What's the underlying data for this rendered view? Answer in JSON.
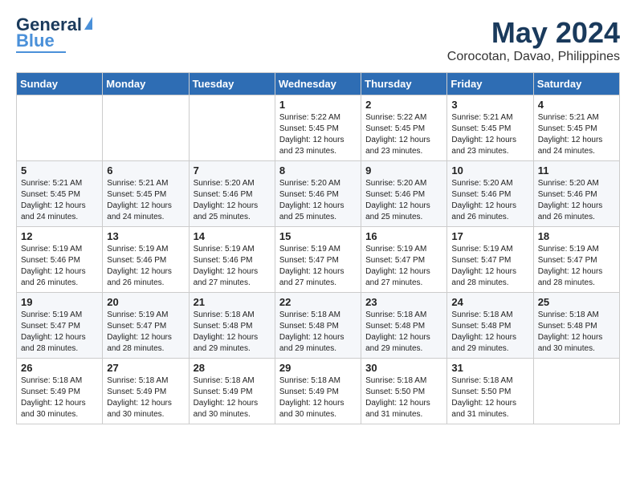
{
  "logo": {
    "line1": "General",
    "line2": "Blue"
  },
  "title": "May 2024",
  "subtitle": "Corocotan, Davao, Philippines",
  "days_of_week": [
    "Sunday",
    "Monday",
    "Tuesday",
    "Wednesday",
    "Thursday",
    "Friday",
    "Saturday"
  ],
  "weeks": [
    [
      {
        "day": "",
        "info": ""
      },
      {
        "day": "",
        "info": ""
      },
      {
        "day": "",
        "info": ""
      },
      {
        "day": "1",
        "info": "Sunrise: 5:22 AM\nSunset: 5:45 PM\nDaylight: 12 hours\nand 23 minutes."
      },
      {
        "day": "2",
        "info": "Sunrise: 5:22 AM\nSunset: 5:45 PM\nDaylight: 12 hours\nand 23 minutes."
      },
      {
        "day": "3",
        "info": "Sunrise: 5:21 AM\nSunset: 5:45 PM\nDaylight: 12 hours\nand 23 minutes."
      },
      {
        "day": "4",
        "info": "Sunrise: 5:21 AM\nSunset: 5:45 PM\nDaylight: 12 hours\nand 24 minutes."
      }
    ],
    [
      {
        "day": "5",
        "info": "Sunrise: 5:21 AM\nSunset: 5:45 PM\nDaylight: 12 hours\nand 24 minutes."
      },
      {
        "day": "6",
        "info": "Sunrise: 5:21 AM\nSunset: 5:45 PM\nDaylight: 12 hours\nand 24 minutes."
      },
      {
        "day": "7",
        "info": "Sunrise: 5:20 AM\nSunset: 5:46 PM\nDaylight: 12 hours\nand 25 minutes."
      },
      {
        "day": "8",
        "info": "Sunrise: 5:20 AM\nSunset: 5:46 PM\nDaylight: 12 hours\nand 25 minutes."
      },
      {
        "day": "9",
        "info": "Sunrise: 5:20 AM\nSunset: 5:46 PM\nDaylight: 12 hours\nand 25 minutes."
      },
      {
        "day": "10",
        "info": "Sunrise: 5:20 AM\nSunset: 5:46 PM\nDaylight: 12 hours\nand 26 minutes."
      },
      {
        "day": "11",
        "info": "Sunrise: 5:20 AM\nSunset: 5:46 PM\nDaylight: 12 hours\nand 26 minutes."
      }
    ],
    [
      {
        "day": "12",
        "info": "Sunrise: 5:19 AM\nSunset: 5:46 PM\nDaylight: 12 hours\nand 26 minutes."
      },
      {
        "day": "13",
        "info": "Sunrise: 5:19 AM\nSunset: 5:46 PM\nDaylight: 12 hours\nand 26 minutes."
      },
      {
        "day": "14",
        "info": "Sunrise: 5:19 AM\nSunset: 5:46 PM\nDaylight: 12 hours\nand 27 minutes."
      },
      {
        "day": "15",
        "info": "Sunrise: 5:19 AM\nSunset: 5:47 PM\nDaylight: 12 hours\nand 27 minutes."
      },
      {
        "day": "16",
        "info": "Sunrise: 5:19 AM\nSunset: 5:47 PM\nDaylight: 12 hours\nand 27 minutes."
      },
      {
        "day": "17",
        "info": "Sunrise: 5:19 AM\nSunset: 5:47 PM\nDaylight: 12 hours\nand 28 minutes."
      },
      {
        "day": "18",
        "info": "Sunrise: 5:19 AM\nSunset: 5:47 PM\nDaylight: 12 hours\nand 28 minutes."
      }
    ],
    [
      {
        "day": "19",
        "info": "Sunrise: 5:19 AM\nSunset: 5:47 PM\nDaylight: 12 hours\nand 28 minutes."
      },
      {
        "day": "20",
        "info": "Sunrise: 5:19 AM\nSunset: 5:47 PM\nDaylight: 12 hours\nand 28 minutes."
      },
      {
        "day": "21",
        "info": "Sunrise: 5:18 AM\nSunset: 5:48 PM\nDaylight: 12 hours\nand 29 minutes."
      },
      {
        "day": "22",
        "info": "Sunrise: 5:18 AM\nSunset: 5:48 PM\nDaylight: 12 hours\nand 29 minutes."
      },
      {
        "day": "23",
        "info": "Sunrise: 5:18 AM\nSunset: 5:48 PM\nDaylight: 12 hours\nand 29 minutes."
      },
      {
        "day": "24",
        "info": "Sunrise: 5:18 AM\nSunset: 5:48 PM\nDaylight: 12 hours\nand 29 minutes."
      },
      {
        "day": "25",
        "info": "Sunrise: 5:18 AM\nSunset: 5:48 PM\nDaylight: 12 hours\nand 30 minutes."
      }
    ],
    [
      {
        "day": "26",
        "info": "Sunrise: 5:18 AM\nSunset: 5:49 PM\nDaylight: 12 hours\nand 30 minutes."
      },
      {
        "day": "27",
        "info": "Sunrise: 5:18 AM\nSunset: 5:49 PM\nDaylight: 12 hours\nand 30 minutes."
      },
      {
        "day": "28",
        "info": "Sunrise: 5:18 AM\nSunset: 5:49 PM\nDaylight: 12 hours\nand 30 minutes."
      },
      {
        "day": "29",
        "info": "Sunrise: 5:18 AM\nSunset: 5:49 PM\nDaylight: 12 hours\nand 30 minutes."
      },
      {
        "day": "30",
        "info": "Sunrise: 5:18 AM\nSunset: 5:50 PM\nDaylight: 12 hours\nand 31 minutes."
      },
      {
        "day": "31",
        "info": "Sunrise: 5:18 AM\nSunset: 5:50 PM\nDaylight: 12 hours\nand 31 minutes."
      },
      {
        "day": "",
        "info": ""
      }
    ]
  ]
}
